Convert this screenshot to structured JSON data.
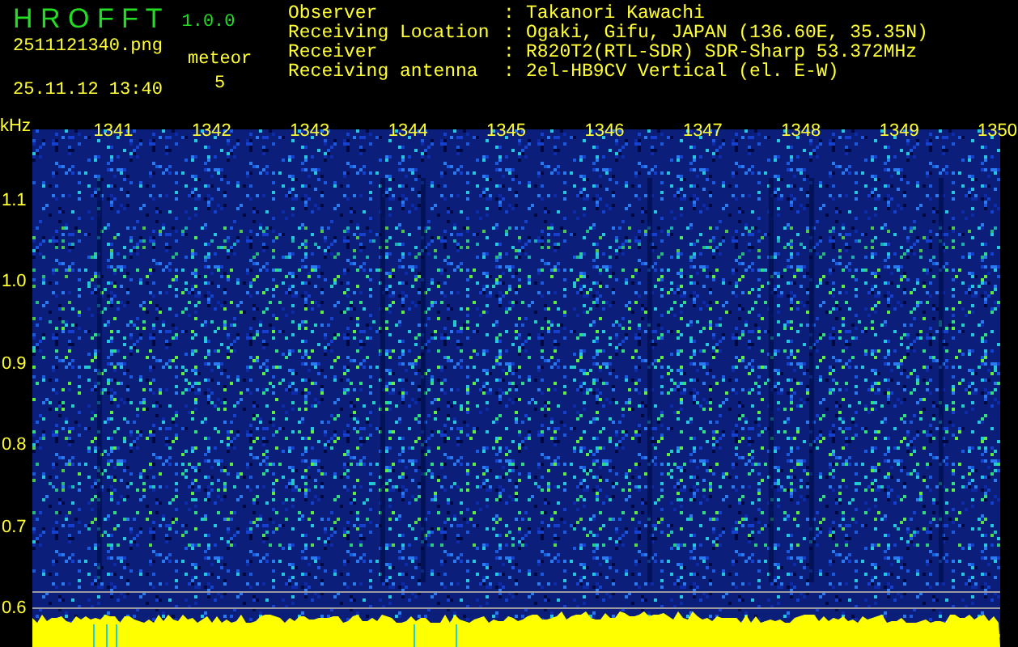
{
  "app": {
    "title": "H R O F F T",
    "version": "1.0.0"
  },
  "file": "2511121340.png",
  "datetime": "25.11.12 13:40",
  "meteor": {
    "label": "meteor",
    "count": "5"
  },
  "info": [
    {
      "label": "Observer",
      "separator": ":",
      "value": "Takanori Kawachi"
    },
    {
      "label": "Receiving Location",
      "separator": ":",
      "value": "Ogaki, Gifu, JAPAN (136.60E, 35.35N)"
    },
    {
      "label": "Receiver",
      "separator": ":",
      "value": "R820T2(RTL-SDR) SDR-Sharp 53.372MHz"
    },
    {
      "label": "Receiving antenna",
      "separator": ":",
      "value": "2el-HB9CV Vertical (el. E-W)"
    }
  ],
  "spectrogram": {
    "unit": "kHz",
    "x_ticks": [
      "1341",
      "1342",
      "1343",
      "1344",
      "1345",
      "1346",
      "1347",
      "1348",
      "1349",
      "1350"
    ],
    "y_ticks": [
      "1.1",
      "1.0",
      "0.9",
      "0.8",
      "0.7",
      "0.6"
    ]
  }
}
